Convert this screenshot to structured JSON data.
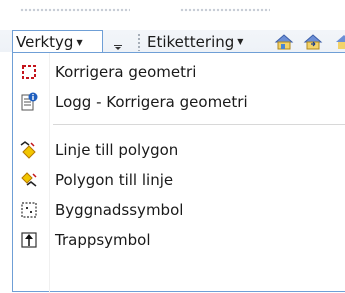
{
  "toolbar": {
    "verktyg_label": "Verktyg",
    "etikettering_label": "Etikettering",
    "verktyg_caret": "▼",
    "etikettering_caret": "▼",
    "overflow_glyph": "▾"
  },
  "menu": {
    "items": [
      {
        "label": "Korrigera geometri",
        "icon": "correct-geometry-icon"
      },
      {
        "label": "Logg - Korrigera geometri",
        "icon": "log-icon"
      },
      {
        "label": "Linje till polygon",
        "icon": "line-to-polygon-icon"
      },
      {
        "label": "Polygon till linje",
        "icon": "polygon-to-line-icon"
      },
      {
        "label": "Byggnadssymbol",
        "icon": "building-symbol-icon"
      },
      {
        "label": "Trappsymbol",
        "icon": "stair-symbol-icon"
      }
    ]
  },
  "colors": {
    "menu_border": "#6f9fd6",
    "correct_geometry_red": "#c4141b",
    "log_blue": "#1f5fbf",
    "yellow": "#f2c600"
  }
}
